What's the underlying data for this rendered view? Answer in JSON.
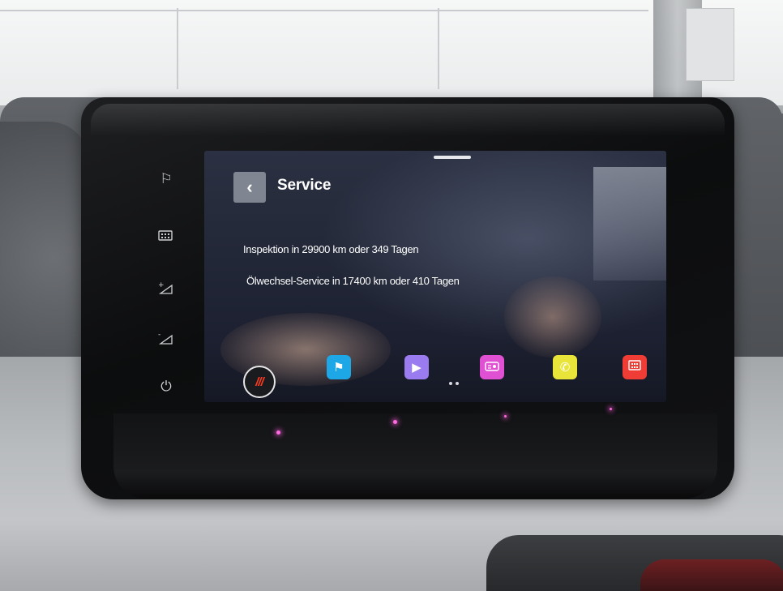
{
  "screen": {
    "title": "Service",
    "back_icon": "chevron-left-icon",
    "service_items": [
      "Inspektion in 29900 km oder 349 Tagen",
      "Ölwechsel-Service in 17400 km oder 410 Tagen"
    ]
  },
  "dock": {
    "home_label": "///",
    "apps": [
      {
        "name": "navigation",
        "icon": "flag-icon",
        "color": "#1ea7e6"
      },
      {
        "name": "media",
        "icon": "play-icon",
        "color": "#9b7cf0"
      },
      {
        "name": "radio",
        "icon": "radio-icon",
        "color": "#e050d2"
      },
      {
        "name": "phone",
        "icon": "phone-icon",
        "color": "#e9e43a"
      },
      {
        "name": "vehicle",
        "icon": "car-settings-icon",
        "color": "#ef3d35"
      }
    ],
    "page_count": 2
  },
  "hard_keys": [
    {
      "name": "nav-key",
      "icon": "flag-icon"
    },
    {
      "name": "car-menu-key",
      "icon": "keypad-icon"
    },
    {
      "name": "volume-up-key",
      "icon": "volume-up-icon"
    },
    {
      "name": "volume-down-key",
      "icon": "volume-down-icon"
    },
    {
      "name": "power-key",
      "icon": "power-icon"
    }
  ]
}
